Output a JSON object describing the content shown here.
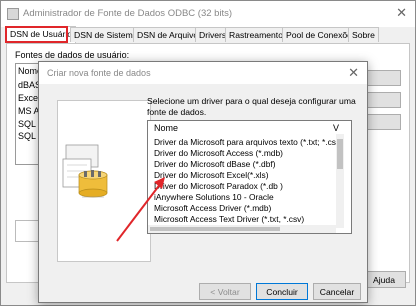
{
  "window": {
    "title": "Administrador de Fonte de Dados ODBC (32 bits)",
    "close_glyph": "✕"
  },
  "tabs": [
    {
      "label": "DSN de Usuário",
      "active": true
    },
    {
      "label": "DSN de Sistema",
      "active": false
    },
    {
      "label": "DSN de Arquivo",
      "active": false
    },
    {
      "label": "Drivers",
      "active": false
    },
    {
      "label": "Rastreamento",
      "active": false
    },
    {
      "label": "Pool de Conexões",
      "active": false
    },
    {
      "label": "Sobre",
      "active": false
    }
  ],
  "panel": {
    "label": "Fontes de dados de usuário:",
    "list_items": [
      "Nome",
      "dBAS",
      "Exce",
      "MS A",
      "SQL",
      "SQL"
    ]
  },
  "outer_buttons": {
    "help": "Ajuda"
  },
  "dialog": {
    "title": "Criar nova fonte de dados",
    "close_glyph": "✕",
    "prompt": "Selecione um driver para o qual deseja configurar uma fonte de dados.",
    "list_header": "Nome",
    "list_header_col2": "V",
    "drivers": [
      "Driver da Microsoft para arquivos texto (*.txt; *.csv)",
      "Driver do Microsoft Access (*.mdb)",
      "Driver do Microsoft dBase (*.dbf)",
      "Driver do Microsoft Excel(*.xls)",
      "Driver do Microsoft Paradox (*.db )",
      "iAnywhere Solutions 10 - Oracle",
      "Microsoft Access Driver (*.mdb)",
      "Microsoft Access Text Driver (*.txt, *.csv)"
    ],
    "buttons": {
      "back": "< Voltar",
      "finish": "Concluir",
      "cancel": "Cancelar"
    }
  },
  "annotation": {
    "arrow_color": "#e0262a",
    "highlight_color": "#e0262a"
  }
}
